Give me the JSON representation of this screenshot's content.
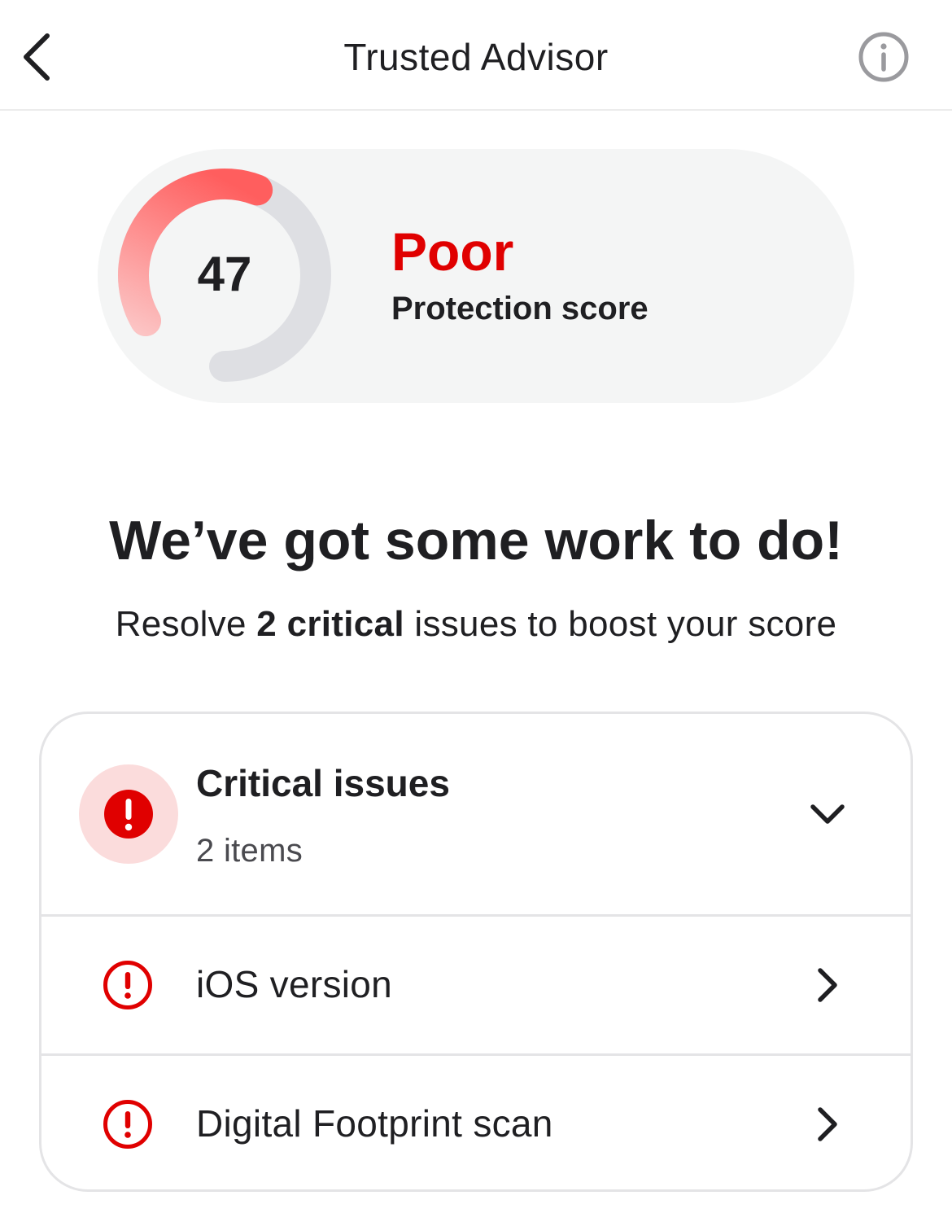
{
  "header": {
    "title": "Trusted Advisor",
    "back_icon": "chevron-left-icon",
    "info_icon": "info-circle-icon"
  },
  "score": {
    "value": 47,
    "value_text": "47",
    "max": 100,
    "rating": "Poor",
    "label": "Protection score",
    "gauge_fill_fraction": 0.47
  },
  "message": {
    "headline": "We’ve got some work to do!",
    "sub_prefix": "Resolve ",
    "sub_bold": "2 critical",
    "sub_suffix": " issues to boost your score"
  },
  "issues": {
    "title": "Critical issues",
    "count_text": "2 items",
    "badge_icon": "exclamation-circle-icon",
    "toggle_icon": "chevron-down-icon",
    "items": [
      {
        "label": "iOS version",
        "icon": "exclamation-outline-icon",
        "chevron": "chevron-right-icon"
      },
      {
        "label": "Digital Footprint scan",
        "icon": "exclamation-outline-icon",
        "chevron": "chevron-right-icon"
      }
    ]
  },
  "colors": {
    "accent_red": "#e00000",
    "gauge_track": "#dedfe3",
    "gauge_start": "#fcc4c4",
    "gauge_end": "#ff5e5e",
    "pill_bg": "#f4f5f5",
    "badge_bg": "#fbdcdc"
  }
}
